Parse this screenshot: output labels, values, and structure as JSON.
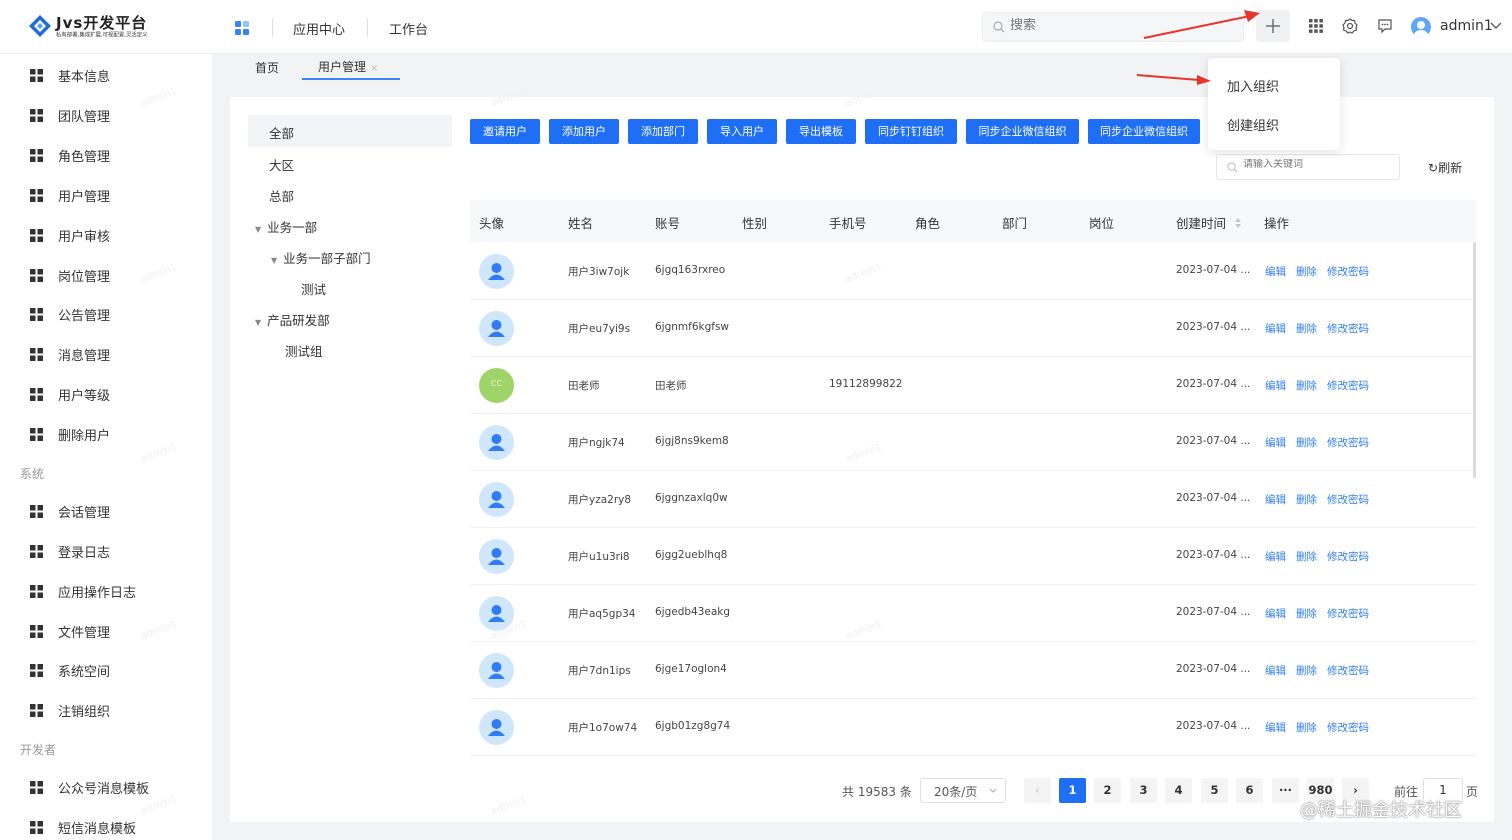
{
  "header": {
    "logo_title": "Jvs开发平台",
    "logo_sub": "私有部署,集成扩展,可视配置,灵活定义",
    "nav": [
      "应用中心",
      "工作台"
    ],
    "search_placeholder": "搜索",
    "username": "admin1"
  },
  "sidebar": {
    "items_a": [
      "基本信息",
      "团队管理",
      "角色管理",
      "用户管理",
      "用户审核",
      "岗位管理",
      "公告管理",
      "消息管理",
      "用户等级",
      "删除用户"
    ],
    "group_system": "系统",
    "items_b": [
      "会话管理",
      "登录日志",
      "应用操作日志",
      "文件管理",
      "系统空间",
      "注销组织"
    ],
    "group_dev": "开发者",
    "items_c": [
      "公众号消息模板",
      "短信消息模板"
    ]
  },
  "tabs": {
    "home": "首页",
    "user_mgmt": "用户管理",
    "close": "×"
  },
  "tree": {
    "all": "全部",
    "region": "大区",
    "hq": "总部",
    "biz1": "业务一部",
    "biz1_sub": "业务一部子部门",
    "test": "测试",
    "rnd": "产品研发部",
    "test_group": "测试组"
  },
  "toolbar": {
    "buttons": [
      "邀请用户",
      "添加用户",
      "添加部门",
      "导入用户",
      "导出模板",
      "同步钉钉组织",
      "同步企业微信组织",
      "同步企业微信组织"
    ],
    "keyword_placeholder": "请输入关键词",
    "refresh": "刷新"
  },
  "table": {
    "headers": [
      "头像",
      "姓名",
      "账号",
      "性别",
      "手机号",
      "角色",
      "部门",
      "岗位",
      "创建时间",
      "操作"
    ],
    "rows": [
      {
        "name": "用户3iw7ojk",
        "account": "6jgq163rxreo",
        "phone": "",
        "created": "2023-07-04 ...",
        "avatar": "default"
      },
      {
        "name": "用户eu7yi9s",
        "account": "6jgnmf6kgfsw",
        "phone": "",
        "created": "2023-07-04 ...",
        "avatar": "default"
      },
      {
        "name": "田老师",
        "account": "田老师",
        "phone": "19112899822",
        "created": "2023-07-04 ...",
        "avatar": "green"
      },
      {
        "name": "用户ngjk74",
        "account": "6jgj8ns9kem8",
        "phone": "",
        "created": "2023-07-04 ...",
        "avatar": "default"
      },
      {
        "name": "用户yza2ry8",
        "account": "6jggnzaxlq0w",
        "phone": "",
        "created": "2023-07-04 ...",
        "avatar": "default"
      },
      {
        "name": "用户u1u3ri8",
        "account": "6jgg2ueblhq8",
        "phone": "",
        "created": "2023-07-04 ...",
        "avatar": "default"
      },
      {
        "name": "用户aq5gp34",
        "account": "6jgedb43eakg",
        "phone": "",
        "created": "2023-07-04 ...",
        "avatar": "default"
      },
      {
        "name": "用户7dn1ips",
        "account": "6jge17oglon4",
        "phone": "",
        "created": "2023-07-04 ...",
        "avatar": "default"
      },
      {
        "name": "用户1o7ow74",
        "account": "6jgb01zg8g74",
        "phone": "",
        "created": "2023-07-04 ...",
        "avatar": "default"
      }
    ],
    "actions": {
      "edit": "编辑",
      "delete": "删除",
      "change_pwd": "修改密码"
    }
  },
  "pagination": {
    "total": "共 19583 条",
    "page_size": "20条/页",
    "pages": [
      "1",
      "2",
      "3",
      "4",
      "5",
      "6",
      "···",
      "980"
    ],
    "current_page": "1",
    "goto_prefix": "前往",
    "goto_value": "1",
    "goto_suffix": "页",
    "prev": "‹",
    "next": "›"
  },
  "dropdown": {
    "join_org": "加入组织",
    "create_org": "创建组织"
  },
  "watermark": "admin1",
  "credit": "@稀土掘金技术社区",
  "colors": {
    "primary": "#1e6ff5",
    "link": "#2f7cf6",
    "arrow": "#e8352c"
  }
}
